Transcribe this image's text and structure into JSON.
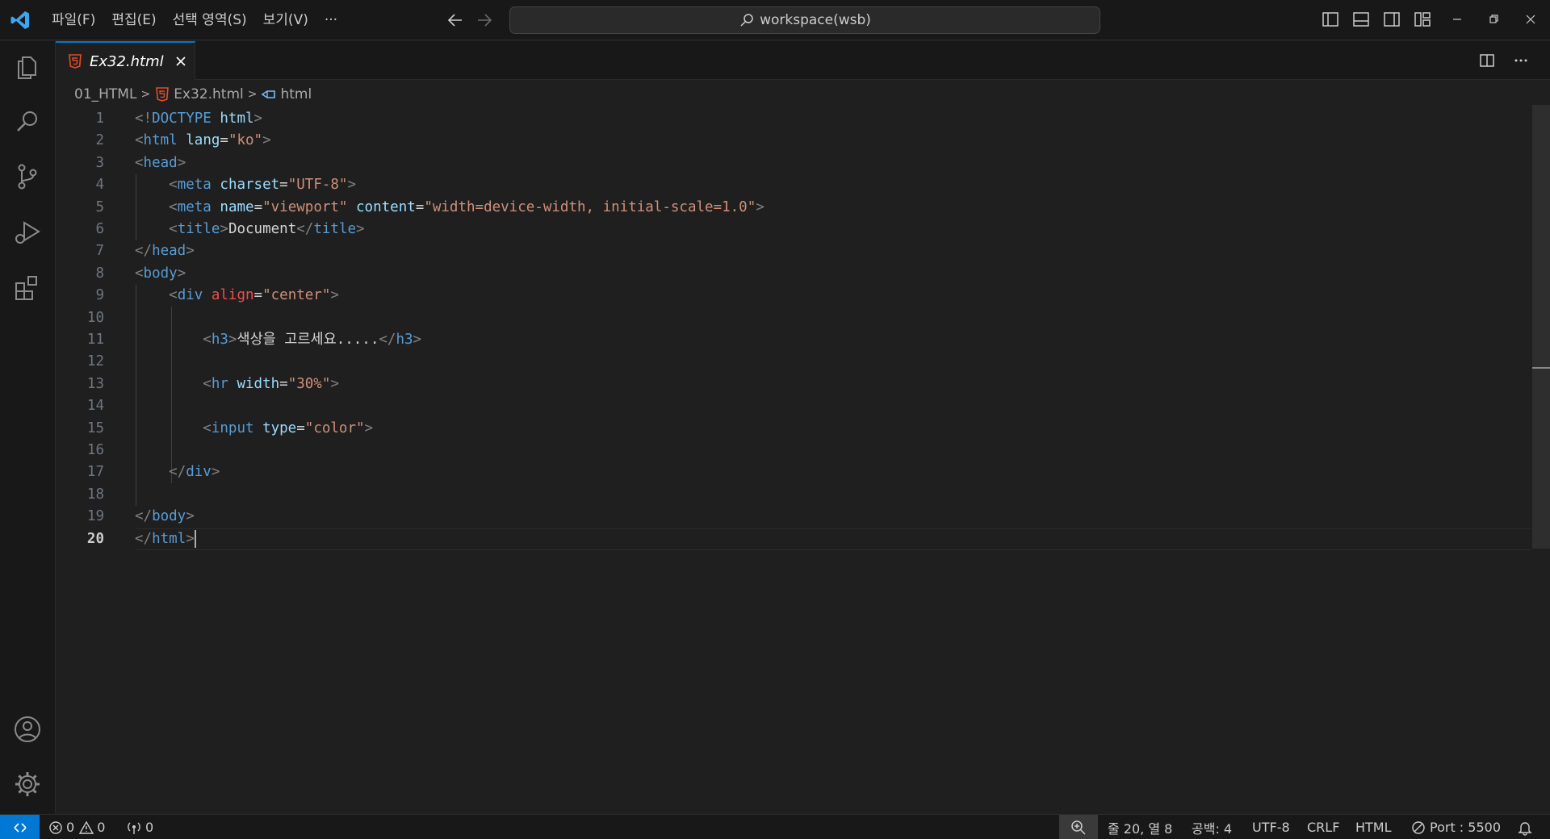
{
  "menu": [
    "파일(F)",
    "편집(E)",
    "선택 영역(S)",
    "보기(V)",
    "···"
  ],
  "search": {
    "label": "workspace(wsb)"
  },
  "tab": {
    "name": "Ex32.html"
  },
  "breadcrumb": {
    "folder": "01_HTML",
    "file": "Ex32.html",
    "symbol": "html"
  },
  "editor": {
    "line_numbers": [
      "1",
      "2",
      "3",
      "4",
      "5",
      "6",
      "7",
      "8",
      "9",
      "10",
      "11",
      "12",
      "13",
      "14",
      "15",
      "16",
      "17",
      "18",
      "19",
      "20"
    ],
    "current_line": 20,
    "lines": [
      [
        [
          "b",
          "<!"
        ],
        [
          "db",
          "DOCTYPE"
        ],
        [
          "tx",
          " "
        ],
        [
          "at",
          "html"
        ],
        [
          "b",
          ">"
        ]
      ],
      [
        [
          "b",
          "<"
        ],
        [
          "tg",
          "html"
        ],
        [
          "tx",
          " "
        ],
        [
          "at",
          "lang"
        ],
        [
          "tx",
          "="
        ],
        [
          "st",
          "\"ko\""
        ],
        [
          "b",
          ">"
        ]
      ],
      [
        [
          "b",
          "<"
        ],
        [
          "tg",
          "head"
        ],
        [
          "b",
          ">"
        ]
      ],
      [
        [
          "tx",
          "    "
        ],
        [
          "b",
          "<"
        ],
        [
          "tg",
          "meta"
        ],
        [
          "tx",
          " "
        ],
        [
          "at",
          "charset"
        ],
        [
          "tx",
          "="
        ],
        [
          "st",
          "\"UTF-8\""
        ],
        [
          "b",
          ">"
        ]
      ],
      [
        [
          "tx",
          "    "
        ],
        [
          "b",
          "<"
        ],
        [
          "tg",
          "meta"
        ],
        [
          "tx",
          " "
        ],
        [
          "at",
          "name"
        ],
        [
          "tx",
          "="
        ],
        [
          "st",
          "\"viewport\""
        ],
        [
          "tx",
          " "
        ],
        [
          "at",
          "content"
        ],
        [
          "tx",
          "="
        ],
        [
          "st",
          "\"width=device-width, initial-scale=1.0\""
        ],
        [
          "b",
          ">"
        ]
      ],
      [
        [
          "tx",
          "    "
        ],
        [
          "b",
          "<"
        ],
        [
          "tg",
          "title"
        ],
        [
          "b",
          ">"
        ],
        [
          "tx",
          "Document"
        ],
        [
          "b",
          "</"
        ],
        [
          "tg",
          "title"
        ],
        [
          "b",
          ">"
        ]
      ],
      [
        [
          "b",
          "</"
        ],
        [
          "tg",
          "head"
        ],
        [
          "b",
          ">"
        ]
      ],
      [
        [
          "b",
          "<"
        ],
        [
          "tg",
          "body"
        ],
        [
          "b",
          ">"
        ]
      ],
      [
        [
          "tx",
          "    "
        ],
        [
          "b",
          "<"
        ],
        [
          "tg",
          "div"
        ],
        [
          "tx",
          " "
        ],
        [
          "er",
          "align"
        ],
        [
          "tx",
          "="
        ],
        [
          "st",
          "\"center\""
        ],
        [
          "b",
          ">"
        ]
      ],
      [],
      [
        [
          "tx",
          "        "
        ],
        [
          "b",
          "<"
        ],
        [
          "tg",
          "h3"
        ],
        [
          "b",
          ">"
        ],
        [
          "tx",
          "색상을 고르세요....."
        ],
        [
          "b",
          "</"
        ],
        [
          "tg",
          "h3"
        ],
        [
          "b",
          ">"
        ]
      ],
      [],
      [
        [
          "tx",
          "        "
        ],
        [
          "b",
          "<"
        ],
        [
          "tg",
          "hr"
        ],
        [
          "tx",
          " "
        ],
        [
          "at",
          "width"
        ],
        [
          "tx",
          "="
        ],
        [
          "st",
          "\"30%\""
        ],
        [
          "b",
          ">"
        ]
      ],
      [],
      [
        [
          "tx",
          "        "
        ],
        [
          "b",
          "<"
        ],
        [
          "tg",
          "input"
        ],
        [
          "tx",
          " "
        ],
        [
          "at",
          "type"
        ],
        [
          "tx",
          "="
        ],
        [
          "st",
          "\"color\""
        ],
        [
          "b",
          ">"
        ]
      ],
      [],
      [
        [
          "tx",
          "    "
        ],
        [
          "b",
          "</"
        ],
        [
          "tg",
          "div"
        ],
        [
          "b",
          ">"
        ]
      ],
      [],
      [
        [
          "b",
          "</"
        ],
        [
          "tg",
          "body"
        ],
        [
          "b",
          ">"
        ]
      ],
      [
        [
          "b",
          "</"
        ],
        [
          "tg",
          "html"
        ],
        [
          "b",
          ">"
        ]
      ]
    ]
  },
  "status": {
    "errors": "0",
    "warnings": "0",
    "ports": "0",
    "position": "줄 20, 열 8",
    "spaces": "공백: 4",
    "encoding": "UTF-8",
    "eol": "CRLF",
    "language": "HTML",
    "port": "Port : 5500"
  },
  "colors": {
    "accent": "#0078d4",
    "html_icon": "#e44d26",
    "background": "#1f1f1f"
  }
}
